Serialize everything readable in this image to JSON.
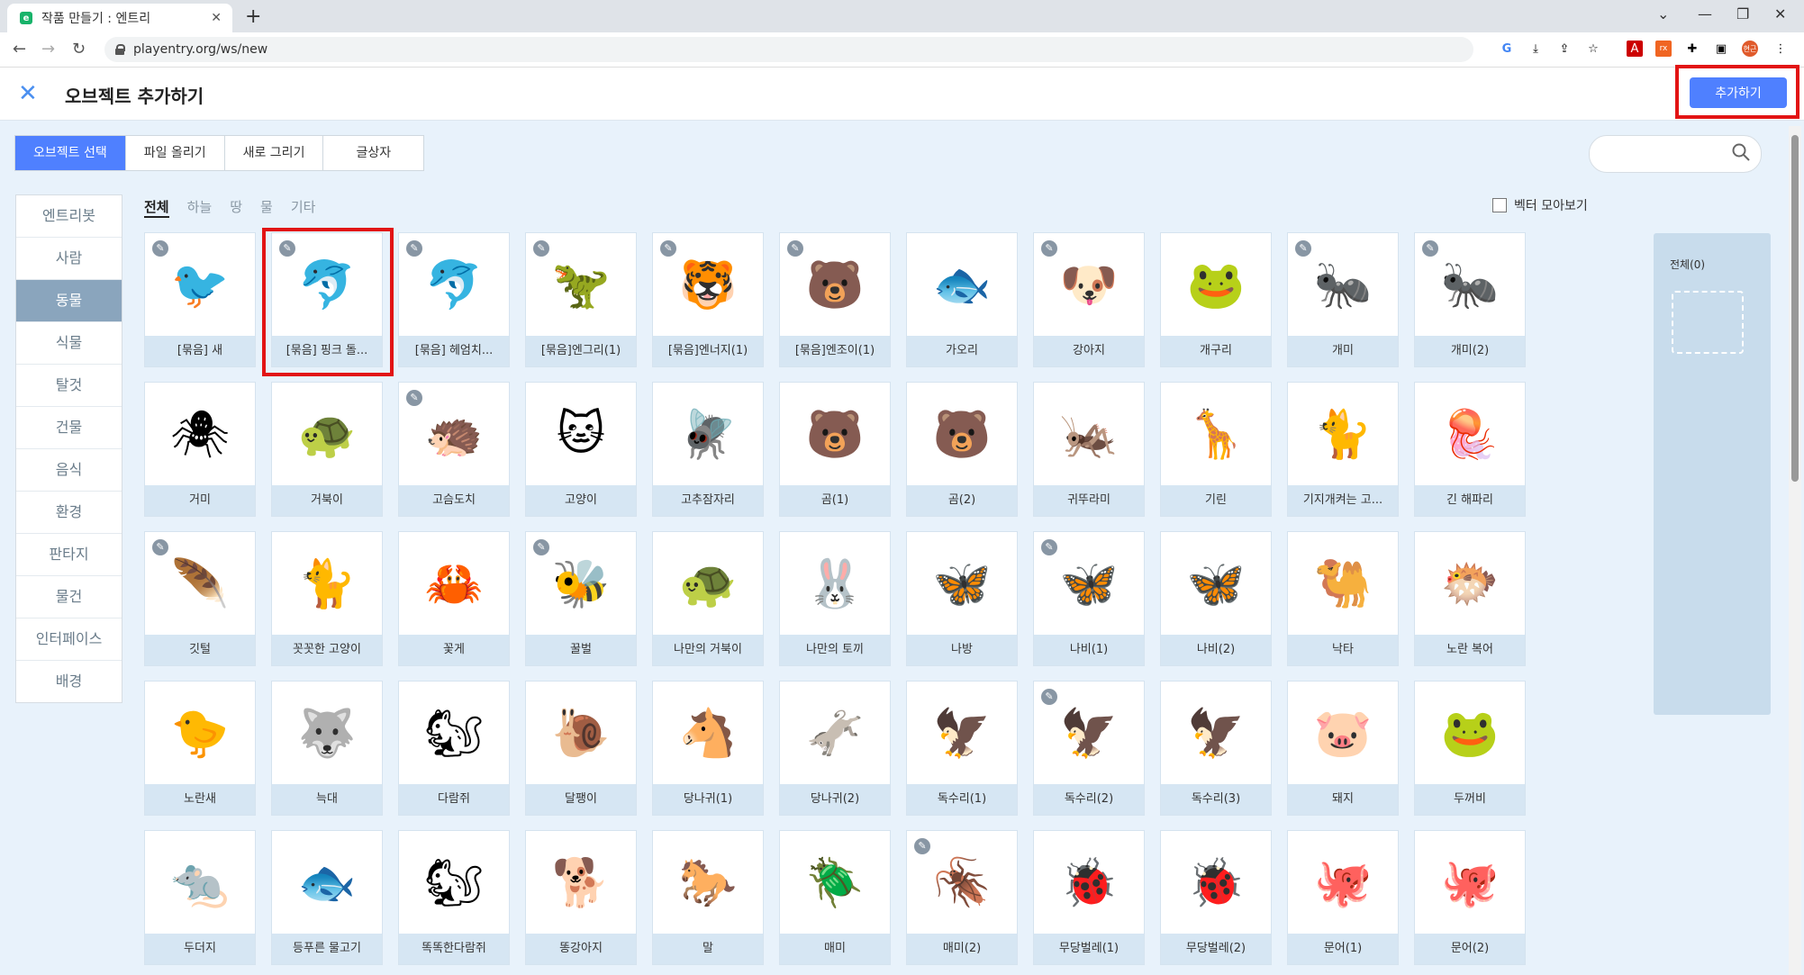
{
  "browser": {
    "tab_title": "작품 만들기 : 엔트리",
    "tab_favicon": "e",
    "url": "playentry.org/ws/new",
    "profile_badge": "현근"
  },
  "header": {
    "title": "오브젝트 추가하기",
    "add_button": "추가하기"
  },
  "mode_tabs": [
    "오브젝트 선택",
    "파일 올리기",
    "새로 그리기",
    "글상자"
  ],
  "sidebar": {
    "items": [
      "엔트리봇",
      "사람",
      "동물",
      "식물",
      "탈것",
      "건물",
      "음식",
      "환경",
      "판타지",
      "물건",
      "인터페이스",
      "배경"
    ],
    "active": "동물"
  },
  "subtabs": [
    "전체",
    "하늘",
    "땅",
    "물",
    "기타"
  ],
  "vector_toggle": "벡터 모아보기",
  "right_panel": {
    "title": "전체(0)"
  },
  "cards": [
    {
      "label": "[묶음] 새",
      "icon": "🐦",
      "pin": true
    },
    {
      "label": "[묶음] 핑크 돌...",
      "icon": "🐬",
      "pin": true
    },
    {
      "label": "[묶음] 헤엄치...",
      "icon": "🐬",
      "pin": true
    },
    {
      "label": "[묶음]엔그리(1)",
      "icon": "🦖",
      "pin": true
    },
    {
      "label": "[묶음]엔너지(1)",
      "icon": "🐯",
      "pin": true
    },
    {
      "label": "[묶음]엔조이(1)",
      "icon": "🐻",
      "pin": true
    },
    {
      "label": "가오리",
      "icon": "🐟",
      "pin": false
    },
    {
      "label": "강아지",
      "icon": "🐶",
      "pin": true
    },
    {
      "label": "개구리",
      "icon": "🐸",
      "pin": false
    },
    {
      "label": "개미",
      "icon": "🐜",
      "pin": true
    },
    {
      "label": "개미(2)",
      "icon": "🐜",
      "pin": true
    },
    {
      "label": "거미",
      "icon": "🕷",
      "pin": false
    },
    {
      "label": "거북이",
      "icon": "🐢",
      "pin": false
    },
    {
      "label": "고슴도치",
      "icon": "🦔",
      "pin": true
    },
    {
      "label": "고양이",
      "icon": "🐱",
      "pin": false
    },
    {
      "label": "고추잠자리",
      "icon": "🪰",
      "pin": false
    },
    {
      "label": "곰(1)",
      "icon": "🐻",
      "pin": false
    },
    {
      "label": "곰(2)",
      "icon": "🐻",
      "pin": false
    },
    {
      "label": "귀뚜라미",
      "icon": "🦗",
      "pin": false
    },
    {
      "label": "기린",
      "icon": "🦒",
      "pin": false
    },
    {
      "label": "기지개켜는 고...",
      "icon": "🐈",
      "pin": false
    },
    {
      "label": "긴 해파리",
      "icon": "🪼",
      "pin": false
    },
    {
      "label": "깃털",
      "icon": "🪶",
      "pin": true
    },
    {
      "label": "꼿꼿한 고양이",
      "icon": "🐈",
      "pin": false
    },
    {
      "label": "꽃게",
      "icon": "🦀",
      "pin": false
    },
    {
      "label": "꿀벌",
      "icon": "🐝",
      "pin": true
    },
    {
      "label": "나만의 거북이",
      "icon": "🐢",
      "pin": false
    },
    {
      "label": "나만의 토끼",
      "icon": "🐰",
      "pin": false
    },
    {
      "label": "나방",
      "icon": "🦋",
      "pin": false
    },
    {
      "label": "나비(1)",
      "icon": "🦋",
      "pin": true
    },
    {
      "label": "나비(2)",
      "icon": "🦋",
      "pin": false
    },
    {
      "label": "낙타",
      "icon": "🐫",
      "pin": false
    },
    {
      "label": "노란 복어",
      "icon": "🐡",
      "pin": false
    },
    {
      "label": "노란새",
      "icon": "🐤",
      "pin": false
    },
    {
      "label": "늑대",
      "icon": "🐺",
      "pin": false
    },
    {
      "label": "다람쥐",
      "icon": "🐿",
      "pin": false
    },
    {
      "label": "달팽이",
      "icon": "🐌",
      "pin": false
    },
    {
      "label": "당나귀(1)",
      "icon": "🐴",
      "pin": false
    },
    {
      "label": "당나귀(2)",
      "icon": "🫏",
      "pin": false
    },
    {
      "label": "독수리(1)",
      "icon": "🦅",
      "pin": false
    },
    {
      "label": "독수리(2)",
      "icon": "🦅",
      "pin": true
    },
    {
      "label": "독수리(3)",
      "icon": "🦅",
      "pin": false
    },
    {
      "label": "돼지",
      "icon": "🐷",
      "pin": false
    },
    {
      "label": "두꺼비",
      "icon": "🐸",
      "pin": false
    },
    {
      "label": "두더지",
      "icon": "🐀",
      "pin": false
    },
    {
      "label": "등푸른 물고기",
      "icon": "🐟",
      "pin": false
    },
    {
      "label": "똑똑한다람쥐",
      "icon": "🐿",
      "pin": false
    },
    {
      "label": "똥강아지",
      "icon": "🐕",
      "pin": false
    },
    {
      "label": "말",
      "icon": "🐎",
      "pin": false
    },
    {
      "label": "매미",
      "icon": "🪲",
      "pin": false
    },
    {
      "label": "매미(2)",
      "icon": "🪳",
      "pin": true
    },
    {
      "label": "무당벌레(1)",
      "icon": "🐞",
      "pin": false
    },
    {
      "label": "무당벌레(2)",
      "icon": "🐞",
      "pin": false
    },
    {
      "label": "문어(1)",
      "icon": "🐙",
      "pin": false
    },
    {
      "label": "문어(2)",
      "icon": "🐙",
      "pin": false
    }
  ]
}
